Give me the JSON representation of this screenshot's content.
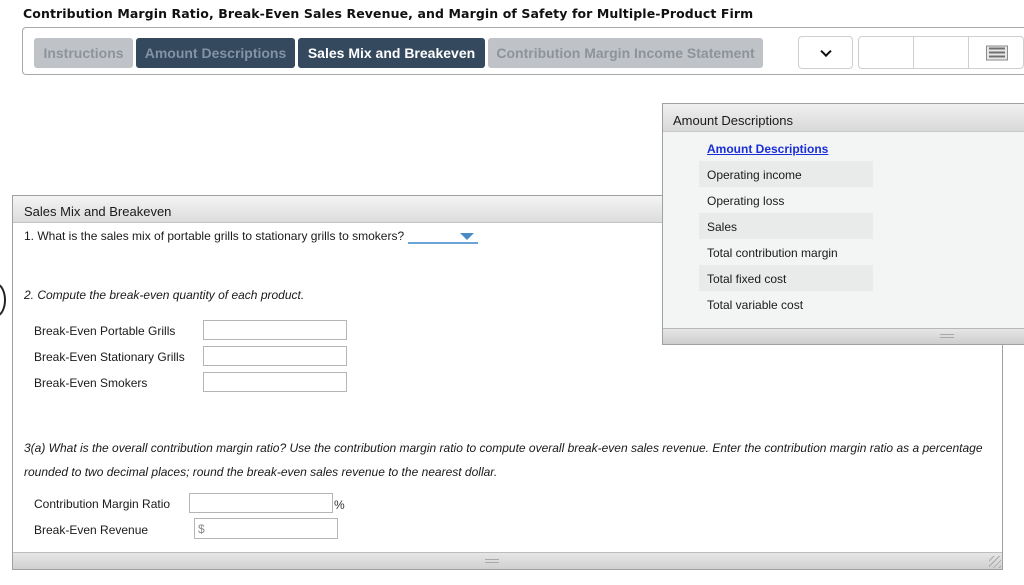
{
  "page": {
    "title": "Contribution Margin Ratio, Break-Even Sales Revenue, and Margin of Safety for Multiple-Product Firm"
  },
  "tabs": [
    {
      "label": "Instructions",
      "state": "inactive"
    },
    {
      "label": "Amount Descriptions",
      "state": "visited"
    },
    {
      "label": "Sales Mix and Breakeven",
      "state": "active"
    },
    {
      "label": "Contribution Margin Income Statement",
      "state": "inactive"
    }
  ],
  "toolbar": {
    "dropdown_icon": "chevron-down-icon",
    "menu_icon": "menu-icon"
  },
  "amount_descriptions": {
    "panel_title": "Amount Descriptions",
    "items": [
      {
        "label": "Amount Descriptions",
        "type": "link"
      },
      {
        "label": "Operating income"
      },
      {
        "label": "Operating loss"
      },
      {
        "label": "Sales"
      },
      {
        "label": "Total contribution margin"
      },
      {
        "label": "Total fixed cost"
      },
      {
        "label": "Total variable cost"
      }
    ]
  },
  "main": {
    "panel_title": "Sales Mix and Breakeven",
    "q1": {
      "text": "1. What is the sales mix of portable grills to stationary grills to smokers?",
      "selected_value": ""
    },
    "q2": {
      "text": "2. Compute the break-even quantity of each product.",
      "rows": [
        {
          "label": "Break-Even Portable Grills",
          "value": ""
        },
        {
          "label": "Break-Even Stationary Grills",
          "value": ""
        },
        {
          "label": "Break-Even Smokers",
          "value": ""
        }
      ]
    },
    "q3": {
      "text": "3(a) What is the overall contribution margin ratio? Use the contribution margin ratio to compute overall break-even sales revenue. Enter the contribution margin ratio as a percentage rounded to two decimal places; round the break-even sales revenue to the nearest dollar.",
      "cm_ratio": {
        "label": "Contribution Margin Ratio",
        "value": "",
        "unit": "%"
      },
      "break_even_revenue": {
        "label": "Break-Even Revenue",
        "value": "",
        "prefix": "$"
      }
    }
  }
}
